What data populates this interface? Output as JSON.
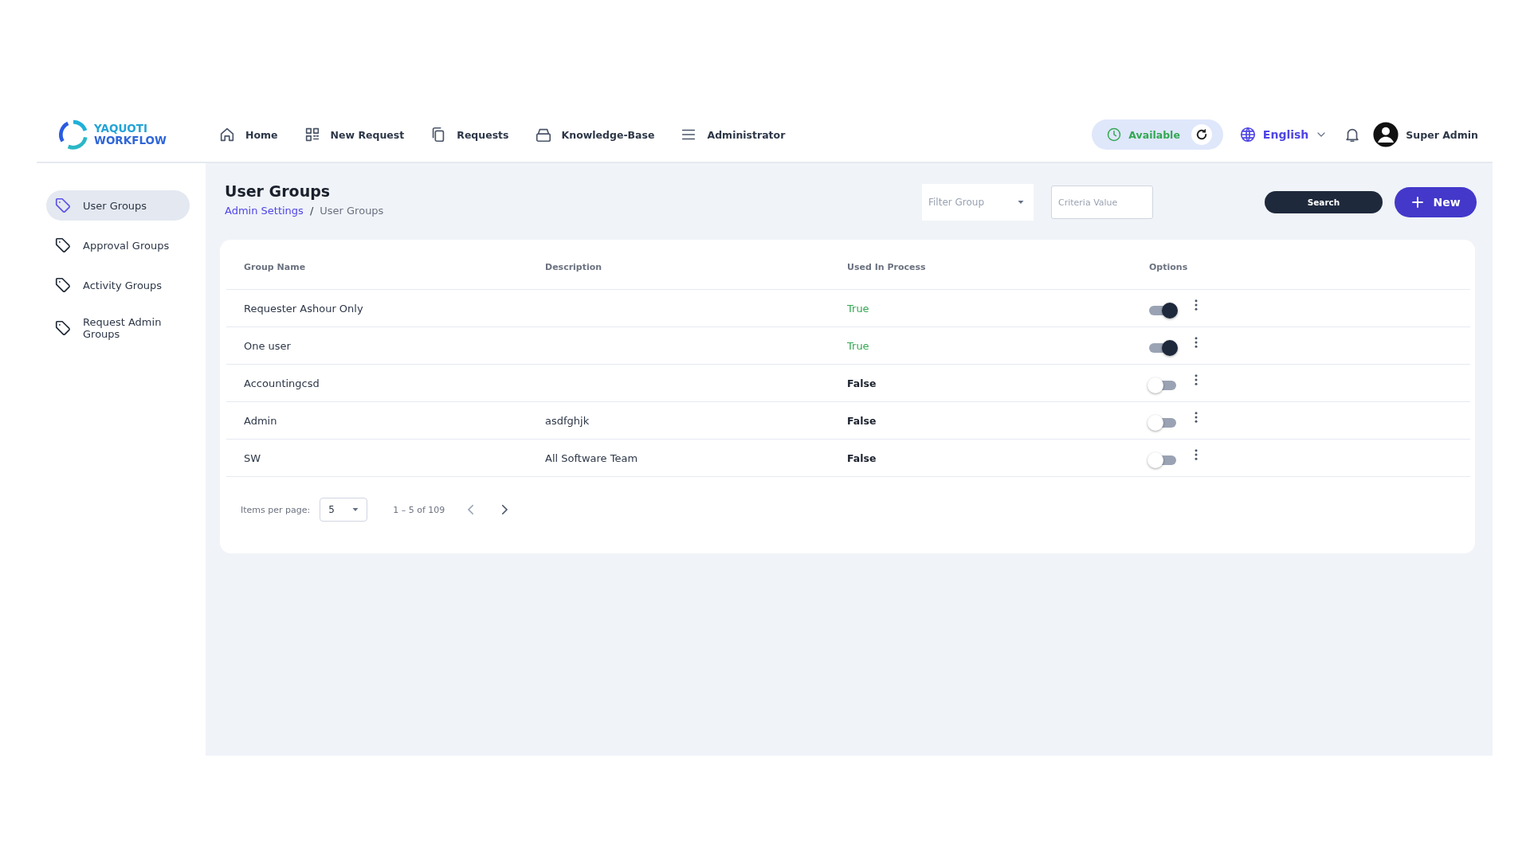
{
  "logo": {
    "line1": "YAQUOTI",
    "line2": "WORKFLOW"
  },
  "nav": [
    {
      "label": "Home"
    },
    {
      "label": "New Request"
    },
    {
      "label": "Requests"
    },
    {
      "label": "Knowledge-Base"
    },
    {
      "label": "Administrator"
    }
  ],
  "status": {
    "label": "Available"
  },
  "language": {
    "label": "English"
  },
  "user": {
    "name": "Super Admin"
  },
  "sidebar": {
    "items": [
      {
        "label": "User Groups",
        "selected": true
      },
      {
        "label": "Approval Groups",
        "selected": false
      },
      {
        "label": "Activity Groups",
        "selected": false
      },
      {
        "label": "Request Admin Groups",
        "selected": false
      }
    ]
  },
  "page": {
    "title": "User Groups",
    "breadcrumb_separator": "/",
    "breadcrumb": [
      {
        "label": "Admin Settings",
        "link": true
      },
      {
        "label": "User Groups",
        "link": false
      }
    ]
  },
  "toolbar": {
    "filter": {
      "placeholder": "Filter Group"
    },
    "criteria": {
      "placeholder": "Criteria Value"
    },
    "search_button": "Search",
    "new_button": "New"
  },
  "table": {
    "columns": [
      "Group Name",
      "Description",
      "Used In Process",
      "Options"
    ],
    "rows": [
      {
        "name": "Requester Ashour Only",
        "used": {
          "text": "True",
          "positive": true
        },
        "on": true
      },
      {
        "name": "One user",
        "used": {
          "text": "True",
          "positive": true
        },
        "on": true
      },
      {
        "name": "Accountingcsd",
        "used": {
          "text": "False",
          "positive": false
        },
        "on": false
      },
      {
        "name": "Admin",
        "description": "asdfghjk",
        "used": {
          "text": "False",
          "positive": false
        },
        "on": false
      },
      {
        "name": "SW",
        "description": "All Software Team",
        "used": {
          "text": "False",
          "positive": false
        },
        "on": false
      }
    ]
  },
  "pagination": {
    "label": "Items per page:",
    "page_size": "5",
    "range": "1 – 5 of 109"
  }
}
